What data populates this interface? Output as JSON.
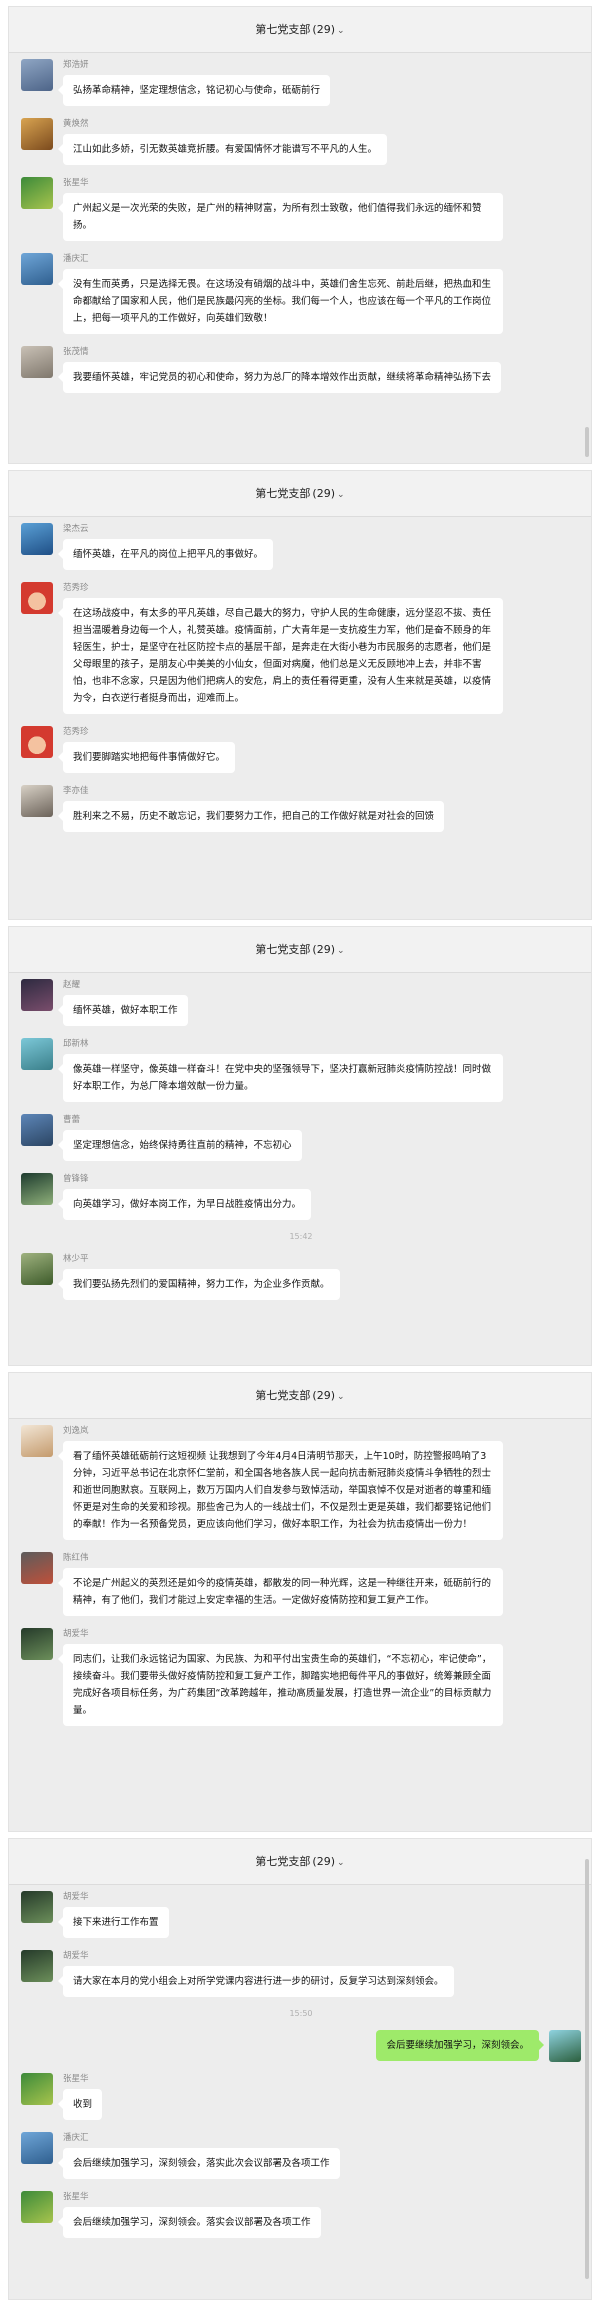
{
  "chat_header": {
    "title": "第七党支部",
    "count": "(29)"
  },
  "panels": [
    {
      "messages": [
        {
          "sender": "郑浩妍",
          "text": "弘扬革命精神，坚定理想信念，铭记初心与使命，砥砺前行"
        },
        {
          "sender": "黄焕然",
          "text": "江山如此多娇，引无数英雄竞折腰。有爱国情怀才能谱写不平凡的人生。"
        },
        {
          "sender": "张星华",
          "text": "广州起义是一次光荣的失败，是广州的精神财富，为所有烈士致敬，他们值得我们永远的缅怀和赞扬。"
        },
        {
          "sender": "潘庆汇",
          "text": "没有生而英勇，只是选择无畏。在这场没有硝烟的战斗中，英雄们舍生忘死、前赴后继，把热血和生命都献给了国家和人民，他们是民族最闪亮的坐标。我们每一个人，也应该在每一个平凡的工作岗位上，把每一项平凡的工作做好，向英雄们致敬！"
        },
        {
          "sender": "张茂情",
          "text": "我要缅怀英雄，牢记党员的初心和使命，努力为总厂的降本增效作出贡献，继续将革命精神弘扬下去"
        }
      ]
    },
    {
      "messages": [
        {
          "sender": "梁杰云",
          "text": "缅怀英雄，在平凡的岗位上把平凡的事做好。"
        },
        {
          "sender": "范秀珍",
          "text": "在这场战疫中，有太多的平凡英雄，尽自己最大的努力，守护人民的生命健康，远分坚忍不拔、责任担当温暖着身边每一个人，礼赞英雄。疫情面前，广大青年是一支抗疫生力军，他们是奋不顾身的年轻医生，护士，是坚守在社区防控卡点的基层干部，是奔走在大街小巷为市民服务的志愿者，他们是父母眼里的孩子，是朋友心中美美的小仙女，但面对病魔，他们总是义无反顾地冲上去，并非不害怕，也非不念家，只是因为他们把病人的安危，肩上的责任看得更重，没有人生来就是英雄，以疫情为令，白衣逆行者挺身而出，迎难而上。"
        },
        {
          "sender": "范秀珍",
          "text": "我们要脚踏实地把每件事情做好它。"
        },
        {
          "sender": "李亦佳",
          "text": "胜利来之不易，历史不敢忘记，我们要努力工作，把自己的工作做好就是对社会的回馈"
        }
      ]
    },
    {
      "messages": [
        {
          "sender": "赵耀",
          "text": "缅怀英雄，做好本职工作"
        },
        {
          "sender": "邱新林",
          "text": "像英雄一样坚守，像英雄一样奋斗！在党中央的坚强领导下，坚决打赢新冠肺炎疫情防控战！同时做好本职工作，为总厂降本增效献一份力量。"
        },
        {
          "sender": "曹蕾",
          "text": "坚定理想信念，始终保持勇往直前的精神，不忘初心"
        },
        {
          "sender": "曾锋锋",
          "text": "向英雄学习，做好本岗工作，为早日战胜疫情出分力。"
        },
        {
          "timestamp": "15:42"
        },
        {
          "sender": "林少平",
          "text": "我们要弘扬先烈们的爱国精神，努力工作，为企业多作贡献。"
        }
      ]
    },
    {
      "messages": [
        {
          "sender": "刘逸岚",
          "text": "看了缅怀英雄砥砺前行这短视频 让我想到了今年4月4日清明节那天，上午10时，防控警报鸣响了3分钟，习近平总书记在北京怀仁堂前，和全国各地各族人民一起向抗击新冠肺炎疫情斗争牺牲的烈士和逝世同胞默哀。互联网上，数万万国内人们自发参与致悼活动，举国哀悼不仅是对逝者的尊重和缅怀更是对生命的关爱和珍视。那些舍己为人的一线战士们，不仅是烈士更是英雄，我们都要铭记他们的奉献！作为一名预备党员，更应该向他们学习，做好本职工作，为社会为抗击疫情出一份力！"
        },
        {
          "sender": "陈红伟",
          "text": "不论是广州起义的英烈还是如今的疫情英雄，都散发的同一种光辉，这是一种继往开来，砥砺前行的精神，有了他们，我们才能过上安定幸福的生活。一定做好疫情防控和复工复产工作。"
        },
        {
          "sender": "胡爱华",
          "text": "同志们，让我们永远铭记为国家、为民族、为和平付出宝贵生命的英雄们，“不忘初心，牢记使命”，接续奋斗。我们要带头做好疫情防控和复工复产工作，脚踏实地把每件平凡的事做好，统筹兼顾全面完成好各项目标任务，为广药集团“改革跨越年，推动高质量发展，打造世界一流企业”的目标贡献力量。"
        }
      ]
    },
    {
      "messages": [
        {
          "sender": "胡爱华",
          "text": "接下来进行工作布置"
        },
        {
          "sender": "胡爱华",
          "text": "请大家在本月的党小组会上对所学党课内容进行进一步的研讨，反复学习达到深刻领会。"
        },
        {
          "timestamp": "15:50"
        },
        {
          "self": true,
          "text": "会后要继续加强学习，深刻领会。"
        },
        {
          "sender": "张星华",
          "text": "收到"
        },
        {
          "sender": "潘庆汇",
          "text": "会后继续加强学习，深刻领会，落实此次会议部署及各项工作"
        },
        {
          "sender": "张星华",
          "text": "会后继续加强学习，深刻领会。落实会议部署及各项工作"
        }
      ]
    }
  ],
  "colors": {
    "panel_bg": "#ededed",
    "bubble_bg": "#ffffff",
    "self_bubble_bg": "#9eea6a",
    "sender_text": "#8a8a8a",
    "timestamp_text": "#b0b0b0"
  }
}
